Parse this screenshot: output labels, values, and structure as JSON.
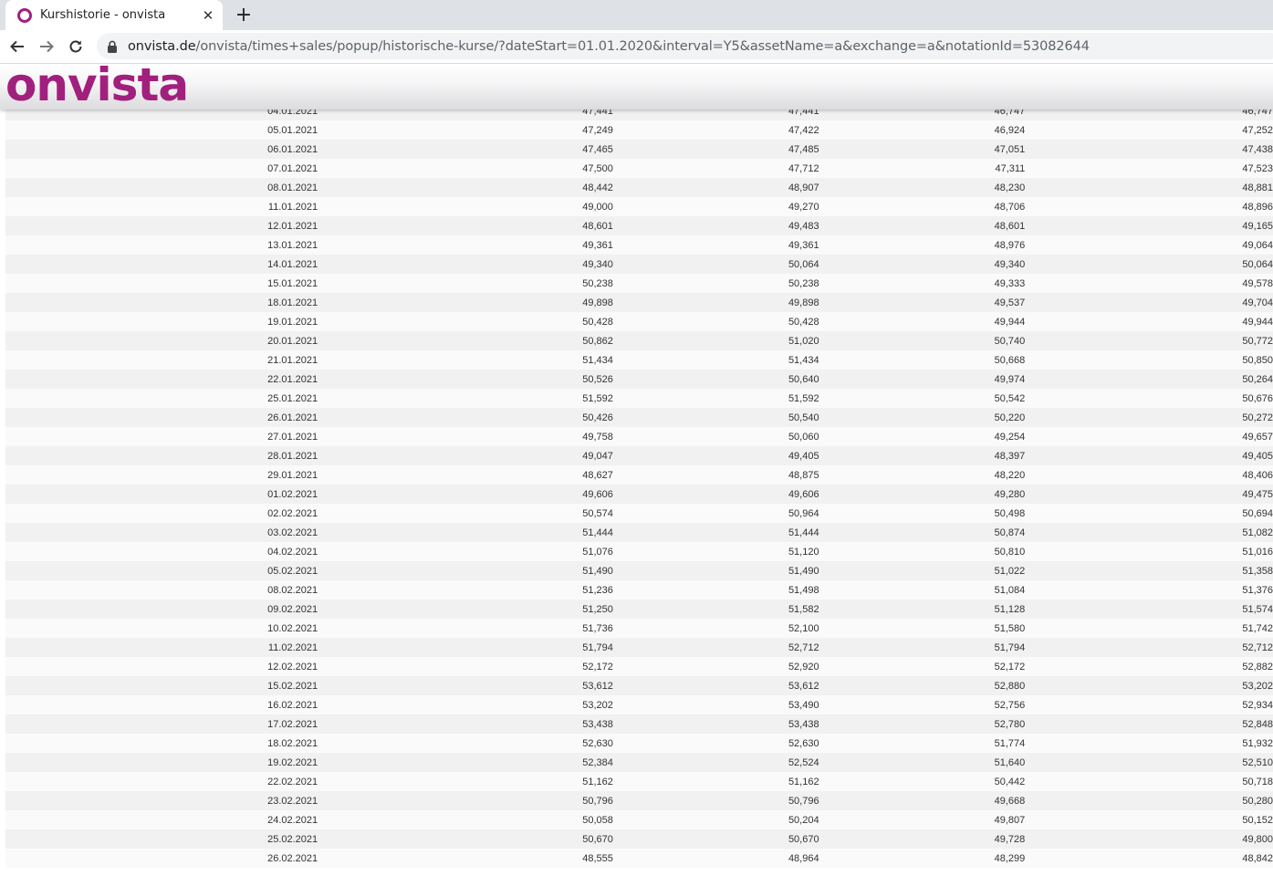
{
  "browser": {
    "tab_title": "Kurshistorie - onvista",
    "tab_close_glyph": "✕",
    "new_tab_glyph": "+",
    "url_host": "onvista.de",
    "url_path": "/onvista/times+sales/popup/historische-kurse/?dateStart=01.01.2020&interval=Y5&assetName=a&exchange=a&notationId=53082644",
    "icons": [
      "back-arrow-icon",
      "forward-arrow-icon",
      "reload-icon",
      "lock-icon"
    ]
  },
  "site": {
    "logo_text": "onvista",
    "brand_color": "#a2207d"
  },
  "table": {
    "rows": [
      [
        "04.01.2021",
        "47,441",
        "47,441",
        "46,747",
        "46,747"
      ],
      [
        "05.01.2021",
        "47,249",
        "47,422",
        "46,924",
        "47,252"
      ],
      [
        "06.01.2021",
        "47,465",
        "47,485",
        "47,051",
        "47,438"
      ],
      [
        "07.01.2021",
        "47,500",
        "47,712",
        "47,311",
        "47,523"
      ],
      [
        "08.01.2021",
        "48,442",
        "48,907",
        "48,230",
        "48,881"
      ],
      [
        "11.01.2021",
        "49,000",
        "49,270",
        "48,706",
        "48,896"
      ],
      [
        "12.01.2021",
        "48,601",
        "49,483",
        "48,601",
        "49,165"
      ],
      [
        "13.01.2021",
        "49,361",
        "49,361",
        "48,976",
        "49,064"
      ],
      [
        "14.01.2021",
        "49,340",
        "50,064",
        "49,340",
        "50,064"
      ],
      [
        "15.01.2021",
        "50,238",
        "50,238",
        "49,333",
        "49,578"
      ],
      [
        "18.01.2021",
        "49,898",
        "49,898",
        "49,537",
        "49,704"
      ],
      [
        "19.01.2021",
        "50,428",
        "50,428",
        "49,944",
        "49,944"
      ],
      [
        "20.01.2021",
        "50,862",
        "51,020",
        "50,740",
        "50,772"
      ],
      [
        "21.01.2021",
        "51,434",
        "51,434",
        "50,668",
        "50,850"
      ],
      [
        "22.01.2021",
        "50,526",
        "50,640",
        "49,974",
        "50,264"
      ],
      [
        "25.01.2021",
        "51,592",
        "51,592",
        "50,542",
        "50,676"
      ],
      [
        "26.01.2021",
        "50,426",
        "50,540",
        "50,220",
        "50,272"
      ],
      [
        "27.01.2021",
        "49,758",
        "50,060",
        "49,254",
        "49,657"
      ],
      [
        "28.01.2021",
        "49,047",
        "49,405",
        "48,397",
        "49,405"
      ],
      [
        "29.01.2021",
        "48,627",
        "48,875",
        "48,220",
        "48,406"
      ],
      [
        "01.02.2021",
        "49,606",
        "49,606",
        "49,280",
        "49,475"
      ],
      [
        "02.02.2021",
        "50,574",
        "50,964",
        "50,498",
        "50,694"
      ],
      [
        "03.02.2021",
        "51,444",
        "51,444",
        "50,874",
        "51,082"
      ],
      [
        "04.02.2021",
        "51,076",
        "51,120",
        "50,810",
        "51,016"
      ],
      [
        "05.02.2021",
        "51,490",
        "51,490",
        "51,022",
        "51,358"
      ],
      [
        "08.02.2021",
        "51,236",
        "51,498",
        "51,084",
        "51,376"
      ],
      [
        "09.02.2021",
        "51,250",
        "51,582",
        "51,128",
        "51,574"
      ],
      [
        "10.02.2021",
        "51,736",
        "52,100",
        "51,580",
        "51,742"
      ],
      [
        "11.02.2021",
        "51,794",
        "52,712",
        "51,794",
        "52,712"
      ],
      [
        "12.02.2021",
        "52,172",
        "52,920",
        "52,172",
        "52,882"
      ],
      [
        "15.02.2021",
        "53,612",
        "53,612",
        "52,880",
        "53,202"
      ],
      [
        "16.02.2021",
        "53,202",
        "53,490",
        "52,756",
        "52,934"
      ],
      [
        "17.02.2021",
        "53,438",
        "53,438",
        "52,780",
        "52,848"
      ],
      [
        "18.02.2021",
        "52,630",
        "52,630",
        "51,774",
        "51,932"
      ],
      [
        "19.02.2021",
        "52,384",
        "52,524",
        "51,640",
        "52,510"
      ],
      [
        "22.02.2021",
        "51,162",
        "51,162",
        "50,442",
        "50,718"
      ],
      [
        "23.02.2021",
        "50,796",
        "50,796",
        "49,668",
        "50,280"
      ],
      [
        "24.02.2021",
        "50,058",
        "50,204",
        "49,807",
        "50,152"
      ],
      [
        "25.02.2021",
        "50,670",
        "50,670",
        "49,728",
        "49,800"
      ],
      [
        "26.02.2021",
        "48,555",
        "48,964",
        "48,299",
        "48,842"
      ]
    ]
  }
}
